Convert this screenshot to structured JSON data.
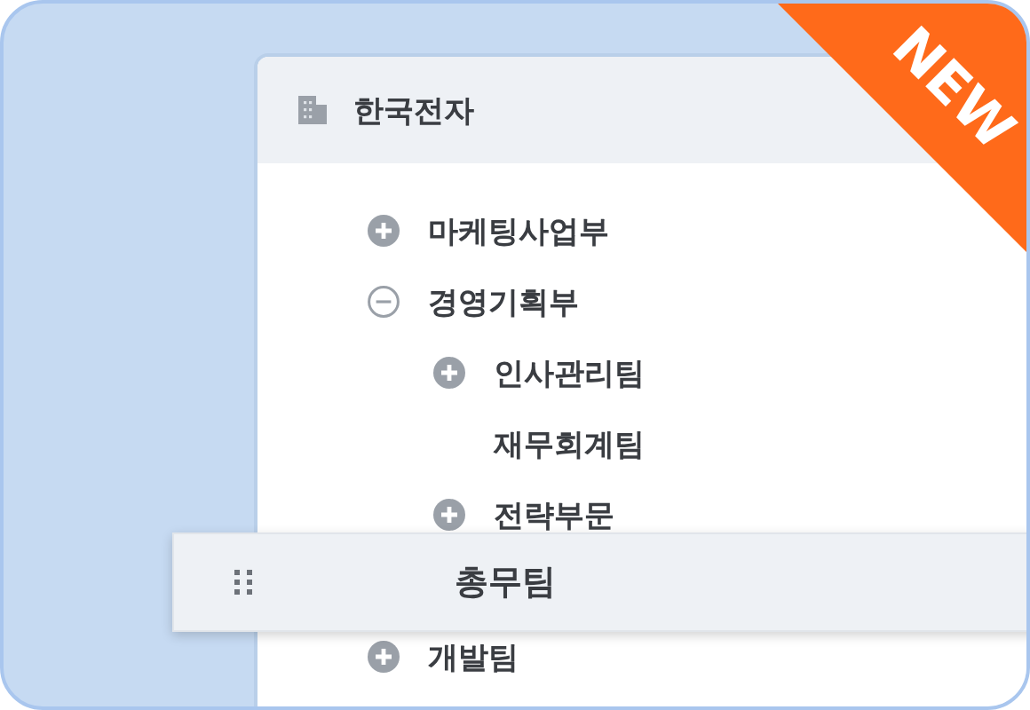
{
  "badge": "NEW",
  "root": {
    "label": "한국전자"
  },
  "tree": [
    {
      "kind": "group",
      "label": "마케팅사업부",
      "expanded": false
    },
    {
      "kind": "group",
      "label": "경영기획부",
      "expanded": true,
      "children": [
        {
          "kind": "group",
          "label": "인사관리팀",
          "expanded": false
        },
        {
          "kind": "leaf",
          "label": "재무회계팀"
        },
        {
          "kind": "group",
          "label": "전략부문",
          "expanded": false
        },
        {
          "kind": "drop-slot"
        }
      ]
    },
    {
      "kind": "group",
      "label": "개발팀",
      "expanded": false
    }
  ],
  "drag_item": {
    "label": "총무팀"
  }
}
